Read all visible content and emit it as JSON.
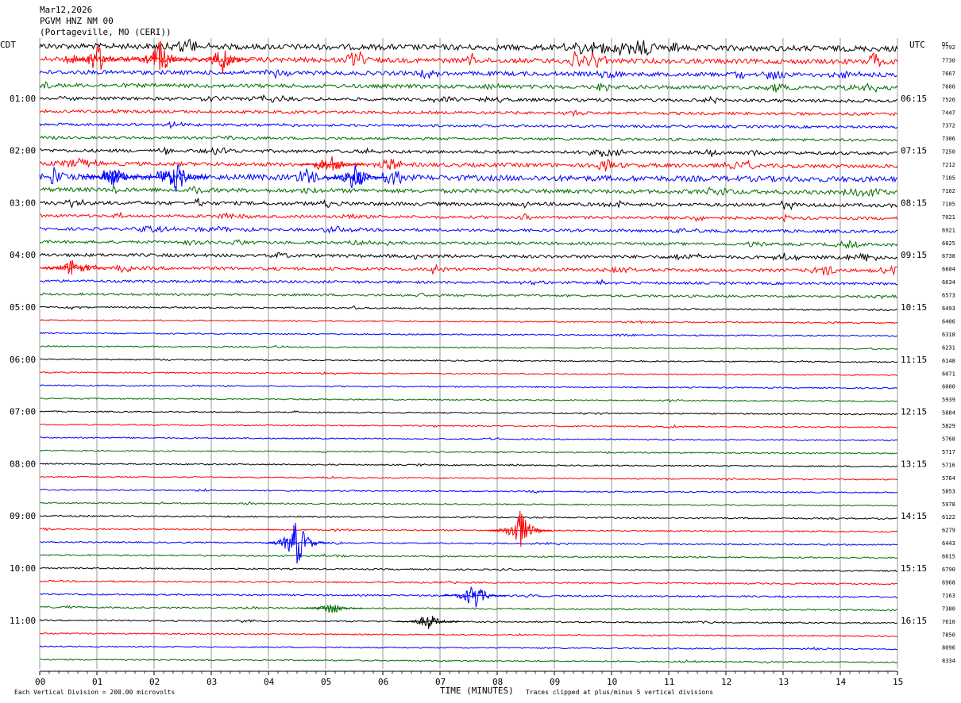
{
  "header": {
    "date": "Mar12,2026",
    "station": "PGVM HNZ NM 00",
    "location": "(Portageville, MO (CERI))",
    "left_zone": "CDT",
    "right_zone": "UTC",
    "dc_label": "DC"
  },
  "footer": {
    "scale_note": "Each Vertical Division =  200.00 microvolts",
    "x_title": "TIME (MINUTES)",
    "clip_note": "Traces clipped at plus/minus 5 vertical divisions"
  },
  "colors": {
    "cycle": [
      "#000000",
      "#ff0000",
      "#0000ff",
      "#007000"
    ],
    "grid": "#808080"
  },
  "chart_data": {
    "type": "line",
    "description_type": "helicorder",
    "x_ticks": [
      "00",
      "01",
      "02",
      "03",
      "04",
      "05",
      "06",
      "07",
      "08",
      "09",
      "10",
      "11",
      "12",
      "13",
      "14",
      "15"
    ],
    "xlim": [
      0,
      15
    ],
    "left_hour_labels": [
      "01:00",
      "02:00",
      "03:00",
      "04:00",
      "05:00",
      "06:00",
      "07:00",
      "08:00",
      "09:00",
      "10:00",
      "11:00"
    ],
    "right_hour_labels": [
      "06:15",
      "07:15",
      "08:15",
      "09:15",
      "10:15",
      "11:15",
      "12:15",
      "13:15",
      "14:15",
      "15:15",
      "16:15"
    ],
    "dc_values": [
      "7792",
      "7730",
      "7667",
      "7600",
      "7526",
      "7447",
      "7372",
      "7306",
      "7250",
      "7212",
      "7185",
      "7162",
      "7105",
      "7021",
      "6921",
      "6825",
      "6738",
      "6604",
      "6634",
      "6573",
      "6493",
      "6406",
      "6318",
      "6231",
      "6148",
      "6071",
      "6000",
      "5939",
      "5884",
      "5829",
      "5768",
      "5717",
      "5716",
      "5764",
      "5853",
      "5978",
      "6122",
      "6279",
      "6443",
      "6615",
      "6790",
      "6968",
      "7163",
      "7380",
      "7610",
      "7850",
      "8096",
      "8334"
    ],
    "row_activity": [
      {
        "noise": 3.5,
        "burst": 9
      },
      {
        "noise": 3.0,
        "burst": 12
      },
      {
        "noise": 2.6,
        "burst": 6
      },
      {
        "noise": 2.4,
        "burst": 5
      },
      {
        "noise": 2.0,
        "burst": 4
      },
      {
        "noise": 1.8,
        "burst": 3
      },
      {
        "noise": 1.6,
        "burst": 3
      },
      {
        "noise": 1.6,
        "burst": 3
      },
      {
        "noise": 2.0,
        "burst": 5
      },
      {
        "noise": 2.4,
        "burst": 7
      },
      {
        "noise": 3.5,
        "burst": 11
      },
      {
        "noise": 2.6,
        "burst": 6
      },
      {
        "noise": 2.2,
        "burst": 5
      },
      {
        "noise": 1.8,
        "burst": 4
      },
      {
        "noise": 1.8,
        "burst": 4
      },
      {
        "noise": 1.8,
        "burst": 4
      },
      {
        "noise": 2.0,
        "burst": 4
      },
      {
        "noise": 2.0,
        "burst": 7
      },
      {
        "noise": 1.6,
        "burst": 3
      },
      {
        "noise": 1.4,
        "burst": 3
      },
      {
        "noise": 1.0,
        "burst": 2
      },
      {
        "noise": 0.8,
        "burst": 1.5
      },
      {
        "noise": 0.8,
        "burst": 1.5
      },
      {
        "noise": 0.8,
        "burst": 1.5
      },
      {
        "noise": 0.8,
        "burst": 1.5
      },
      {
        "noise": 0.8,
        "burst": 1.5
      },
      {
        "noise": 0.8,
        "burst": 1.5
      },
      {
        "noise": 0.8,
        "burst": 1.5
      },
      {
        "noise": 0.8,
        "burst": 1.5
      },
      {
        "noise": 0.8,
        "burst": 1.5
      },
      {
        "noise": 0.8,
        "burst": 1.5
      },
      {
        "noise": 0.8,
        "burst": 1.5
      },
      {
        "noise": 0.8,
        "burst": 1.5
      },
      {
        "noise": 0.8,
        "burst": 1.5
      },
      {
        "noise": 0.8,
        "burst": 1.5
      },
      {
        "noise": 0.8,
        "burst": 1.5
      },
      {
        "noise": 0.9,
        "burst": 1.5
      },
      {
        "noise": 0.9,
        "burst": 1.5
      },
      {
        "noise": 0.9,
        "burst": 1.5
      },
      {
        "noise": 0.9,
        "burst": 1.5
      },
      {
        "noise": 0.9,
        "burst": 1.5
      },
      {
        "noise": 1.0,
        "burst": 1.5
      },
      {
        "noise": 1.0,
        "burst": 1.5
      },
      {
        "noise": 1.0,
        "burst": 1.5
      },
      {
        "noise": 0.9,
        "burst": 1.5
      },
      {
        "noise": 0.8,
        "burst": 1.5
      },
      {
        "noise": 0.8,
        "burst": 1.5
      },
      {
        "noise": 0.8,
        "burst": 1.5
      }
    ],
    "events": [
      {
        "row": 1,
        "minute": 1.0,
        "amp": 22
      },
      {
        "row": 1,
        "minute": 2.1,
        "amp": 26
      },
      {
        "row": 1,
        "minute": 3.2,
        "amp": 20
      },
      {
        "row": 9,
        "minute": 5.1,
        "amp": 14
      },
      {
        "row": 10,
        "minute": 1.3,
        "amp": 16
      },
      {
        "row": 10,
        "minute": 2.4,
        "amp": 22
      },
      {
        "row": 10,
        "minute": 5.5,
        "amp": 18
      },
      {
        "row": 17,
        "minute": 0.6,
        "amp": 16
      },
      {
        "row": 38,
        "minute": 4.5,
        "amp": 34
      },
      {
        "row": 37,
        "minute": 8.4,
        "amp": 28
      },
      {
        "row": 42,
        "minute": 7.6,
        "amp": 20
      },
      {
        "row": 43,
        "minute": 5.1,
        "amp": 10
      },
      {
        "row": 44,
        "minute": 6.8,
        "amp": 12
      }
    ]
  }
}
